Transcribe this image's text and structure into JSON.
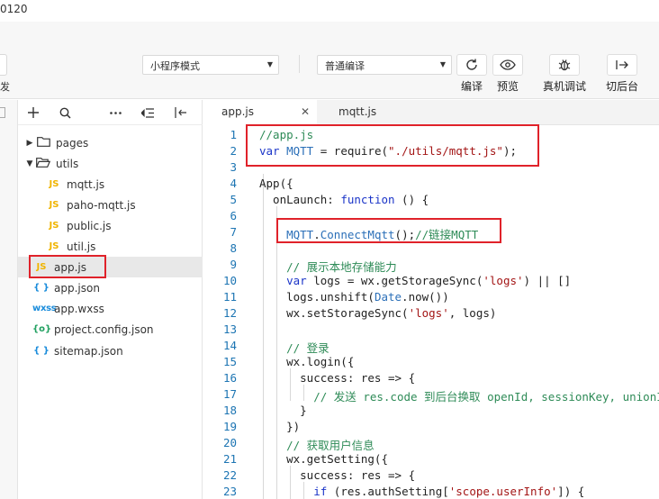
{
  "window": {
    "title": "0120"
  },
  "toolbar": {
    "edge_label": "发",
    "mode_select": "小程序模式",
    "compile_select": "普通编译",
    "tools": [
      {
        "label": "编译",
        "icon": "refresh-icon"
      },
      {
        "label": "预览",
        "icon": "eye-icon"
      },
      {
        "label": "真机调试",
        "icon": "bug-icon"
      },
      {
        "label": "切后台",
        "icon": "switch-background-icon"
      }
    ]
  },
  "explorer": {
    "tree": [
      {
        "name": "pages",
        "type": "folder",
        "expanded": false
      },
      {
        "name": "utils",
        "type": "folder",
        "expanded": true
      },
      {
        "name": "mqtt.js",
        "type": "js"
      },
      {
        "name": "paho-mqtt.js",
        "type": "js"
      },
      {
        "name": "public.js",
        "type": "js"
      },
      {
        "name": "util.js",
        "type": "js"
      },
      {
        "name": "app.js",
        "type": "js",
        "active": true
      },
      {
        "name": "app.json",
        "type": "json"
      },
      {
        "name": "app.wxss",
        "type": "wxss"
      },
      {
        "name": "project.config.json",
        "type": "config"
      },
      {
        "name": "sitemap.json",
        "type": "json"
      }
    ],
    "icon_text": {
      "js": "JS",
      "json": "{ }",
      "wxss": "wxss",
      "config": "{o}"
    }
  },
  "editor": {
    "tabs": [
      {
        "label": "app.js",
        "active": true
      },
      {
        "label": "mqtt.js",
        "active": false
      }
    ],
    "line_numbers": [
      "1",
      "2",
      "3",
      "4",
      "5",
      "6",
      "7",
      "8",
      "9",
      "10",
      "11",
      "12",
      "13",
      "14",
      "15",
      "16",
      "17",
      "18",
      "19",
      "20",
      "21",
      "22",
      "23"
    ],
    "lines": [
      [
        {
          "t": "//app.js",
          "c": "com"
        }
      ],
      [
        {
          "t": "var ",
          "c": "kw"
        },
        {
          "t": "MQTT",
          "c": "var"
        },
        {
          "t": " = require(",
          "c": ""
        },
        {
          "t": "\"./utils/mqtt.js\"",
          "c": "str"
        },
        {
          "t": ");",
          "c": ""
        }
      ],
      [],
      [
        {
          "t": "App({",
          "c": ""
        }
      ],
      [
        {
          "t": "  onLaunch: ",
          "c": ""
        },
        {
          "t": "function",
          "c": "kw"
        },
        {
          "t": " () {",
          "c": ""
        }
      ],
      [],
      [
        {
          "t": "    ",
          "c": ""
        },
        {
          "t": "MQTT",
          "c": "var"
        },
        {
          "t": ".",
          "c": ""
        },
        {
          "t": "ConnectMqtt",
          "c": "fn"
        },
        {
          "t": "();",
          "c": ""
        },
        {
          "t": "//链接MQTT",
          "c": "com"
        }
      ],
      [],
      [
        {
          "t": "    ",
          "c": ""
        },
        {
          "t": "// 展示本地存储能力",
          "c": "com"
        }
      ],
      [
        {
          "t": "    ",
          "c": ""
        },
        {
          "t": "var ",
          "c": "kw"
        },
        {
          "t": "logs = wx.getStorageSync(",
          "c": ""
        },
        {
          "t": "'logs'",
          "c": "str"
        },
        {
          "t": ") || []",
          "c": ""
        }
      ],
      [
        {
          "t": "    logs.unshift(",
          "c": ""
        },
        {
          "t": "Date",
          "c": "var"
        },
        {
          "t": ".now())",
          "c": ""
        }
      ],
      [
        {
          "t": "    wx.setStorageSync(",
          "c": ""
        },
        {
          "t": "'logs'",
          "c": "str"
        },
        {
          "t": ", logs)",
          "c": ""
        }
      ],
      [],
      [
        {
          "t": "    ",
          "c": ""
        },
        {
          "t": "// 登录",
          "c": "com"
        }
      ],
      [
        {
          "t": "    wx.login({",
          "c": ""
        }
      ],
      [
        {
          "t": "      success: res => {",
          "c": ""
        }
      ],
      [
        {
          "t": "        ",
          "c": ""
        },
        {
          "t": "// 发送 res.code 到后台换取 openId, sessionKey, unionId",
          "c": "com"
        }
      ],
      [
        {
          "t": "      }",
          "c": ""
        }
      ],
      [
        {
          "t": "    })",
          "c": ""
        }
      ],
      [
        {
          "t": "    ",
          "c": ""
        },
        {
          "t": "// 获取用户信息",
          "c": "com"
        }
      ],
      [
        {
          "t": "    wx.getSetting({",
          "c": ""
        }
      ],
      [
        {
          "t": "      success: res => {",
          "c": ""
        }
      ],
      [
        {
          "t": "        ",
          "c": ""
        },
        {
          "t": "if",
          "c": "kw"
        },
        {
          "t": " (res.authSetting[",
          "c": ""
        },
        {
          "t": "'scope.userInfo'",
          "c": "str"
        },
        {
          "t": "]) {",
          "c": ""
        }
      ]
    ]
  }
}
